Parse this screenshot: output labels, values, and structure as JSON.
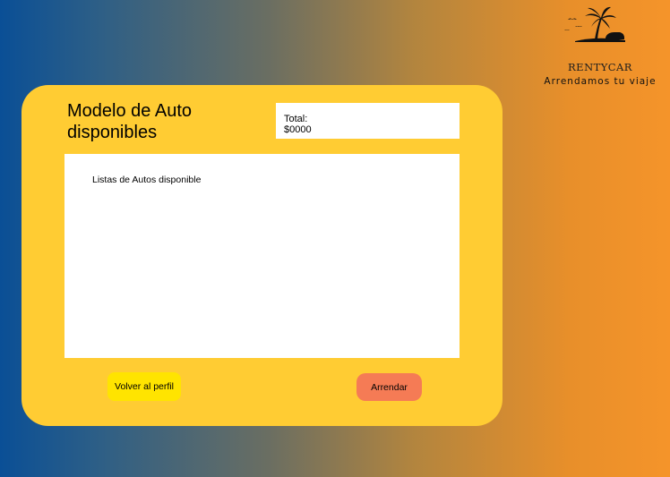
{
  "brand": {
    "name": "RENTYCAR",
    "tagline": "Arrendamos tu viaje",
    "logo_icon": "palm-tree-island-icon"
  },
  "card": {
    "title_line1": "Modelo de Auto",
    "title_line2": "disponibles",
    "total_label": "Total:",
    "total_value": "$0000",
    "list_placeholder": "Listas de Autos disponible"
  },
  "actions": {
    "back_label": "Volver al perfil",
    "rent_label": "Arrendar"
  },
  "colors": {
    "card": "#ffcc33",
    "back_button": "#ffe400",
    "rent_button": "#f57b55",
    "gradient_left": "#0a4f96",
    "gradient_right": "#f5942a"
  }
}
